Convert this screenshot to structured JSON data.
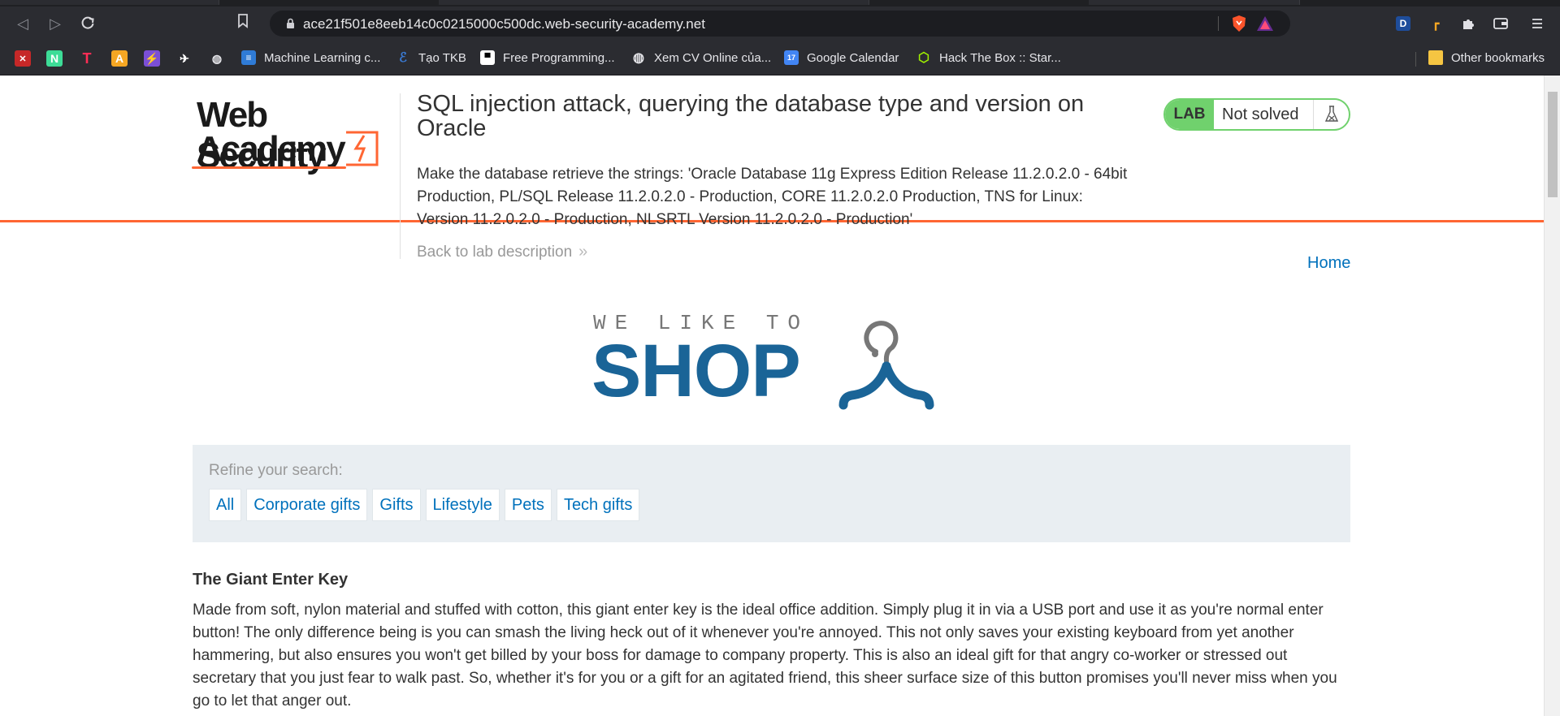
{
  "browser": {
    "url": "ace21f501e8eeb14c0c0215000c500dc.web-security-academy.net",
    "bookmarks": [
      {
        "label": "Machine Learning c...",
        "icon": "ml-icon"
      },
      {
        "label": "Tạo TKB",
        "icon": "tkb-icon"
      },
      {
        "label": "Free Programming...",
        "icon": "fp-icon"
      },
      {
        "label": "Xem CV Online của...",
        "icon": "globe-icon"
      },
      {
        "label": "Google Calendar",
        "icon": "calendar-icon"
      },
      {
        "label": "Hack The Box :: Star...",
        "icon": "htb-icon"
      }
    ],
    "other_bookmarks": "Other bookmarks",
    "calendar_day": "17"
  },
  "lab": {
    "title": "SQL injection attack, querying the database type and version on Oracle",
    "description": "Make the database retrieve the strings: 'Oracle Database 11g Express Edition Release 11.2.0.2.0 - 64bit Production, PL/SQL Release 11.2.0.2.0 - Production, CORE 11.2.0.2.0 Production, TNS for Linux: Version 11.2.0.2.0 - Production, NLSRTL Version 11.2.0.2.0 - Production'",
    "back_link": "Back to lab description",
    "badge_label": "LAB",
    "status": "Not solved",
    "accent_color": "#ff6633",
    "status_color": "#70d16d"
  },
  "logo": {
    "line1": "Web Security",
    "line2": "Academy"
  },
  "nav": {
    "home": "Home"
  },
  "shop": {
    "tagline": "WE LIKE TO",
    "name": "SHOP"
  },
  "filter": {
    "label": "Refine your search:",
    "categories": [
      "All",
      "Corporate gifts",
      "Gifts",
      "Lifestyle",
      "Pets",
      "Tech gifts"
    ]
  },
  "product": {
    "title": "The Giant Enter Key",
    "description": "Made from soft, nylon material and stuffed with cotton, this giant enter key is the ideal office addition. Simply plug it in via a USB port and use it as you're normal enter button! The only difference being is you can smash the living heck out of it whenever you're annoyed. This not only saves your existing keyboard from yet another hammering, but also ensures you won't get billed by your boss for damage to company property. This is also an ideal gift for that angry co-worker or stressed out secretary that you just fear to walk past. So, whether it's for you or a gift for an agitated friend, this sheer surface size of this button promises you'll never miss when you go to let that anger out."
  }
}
